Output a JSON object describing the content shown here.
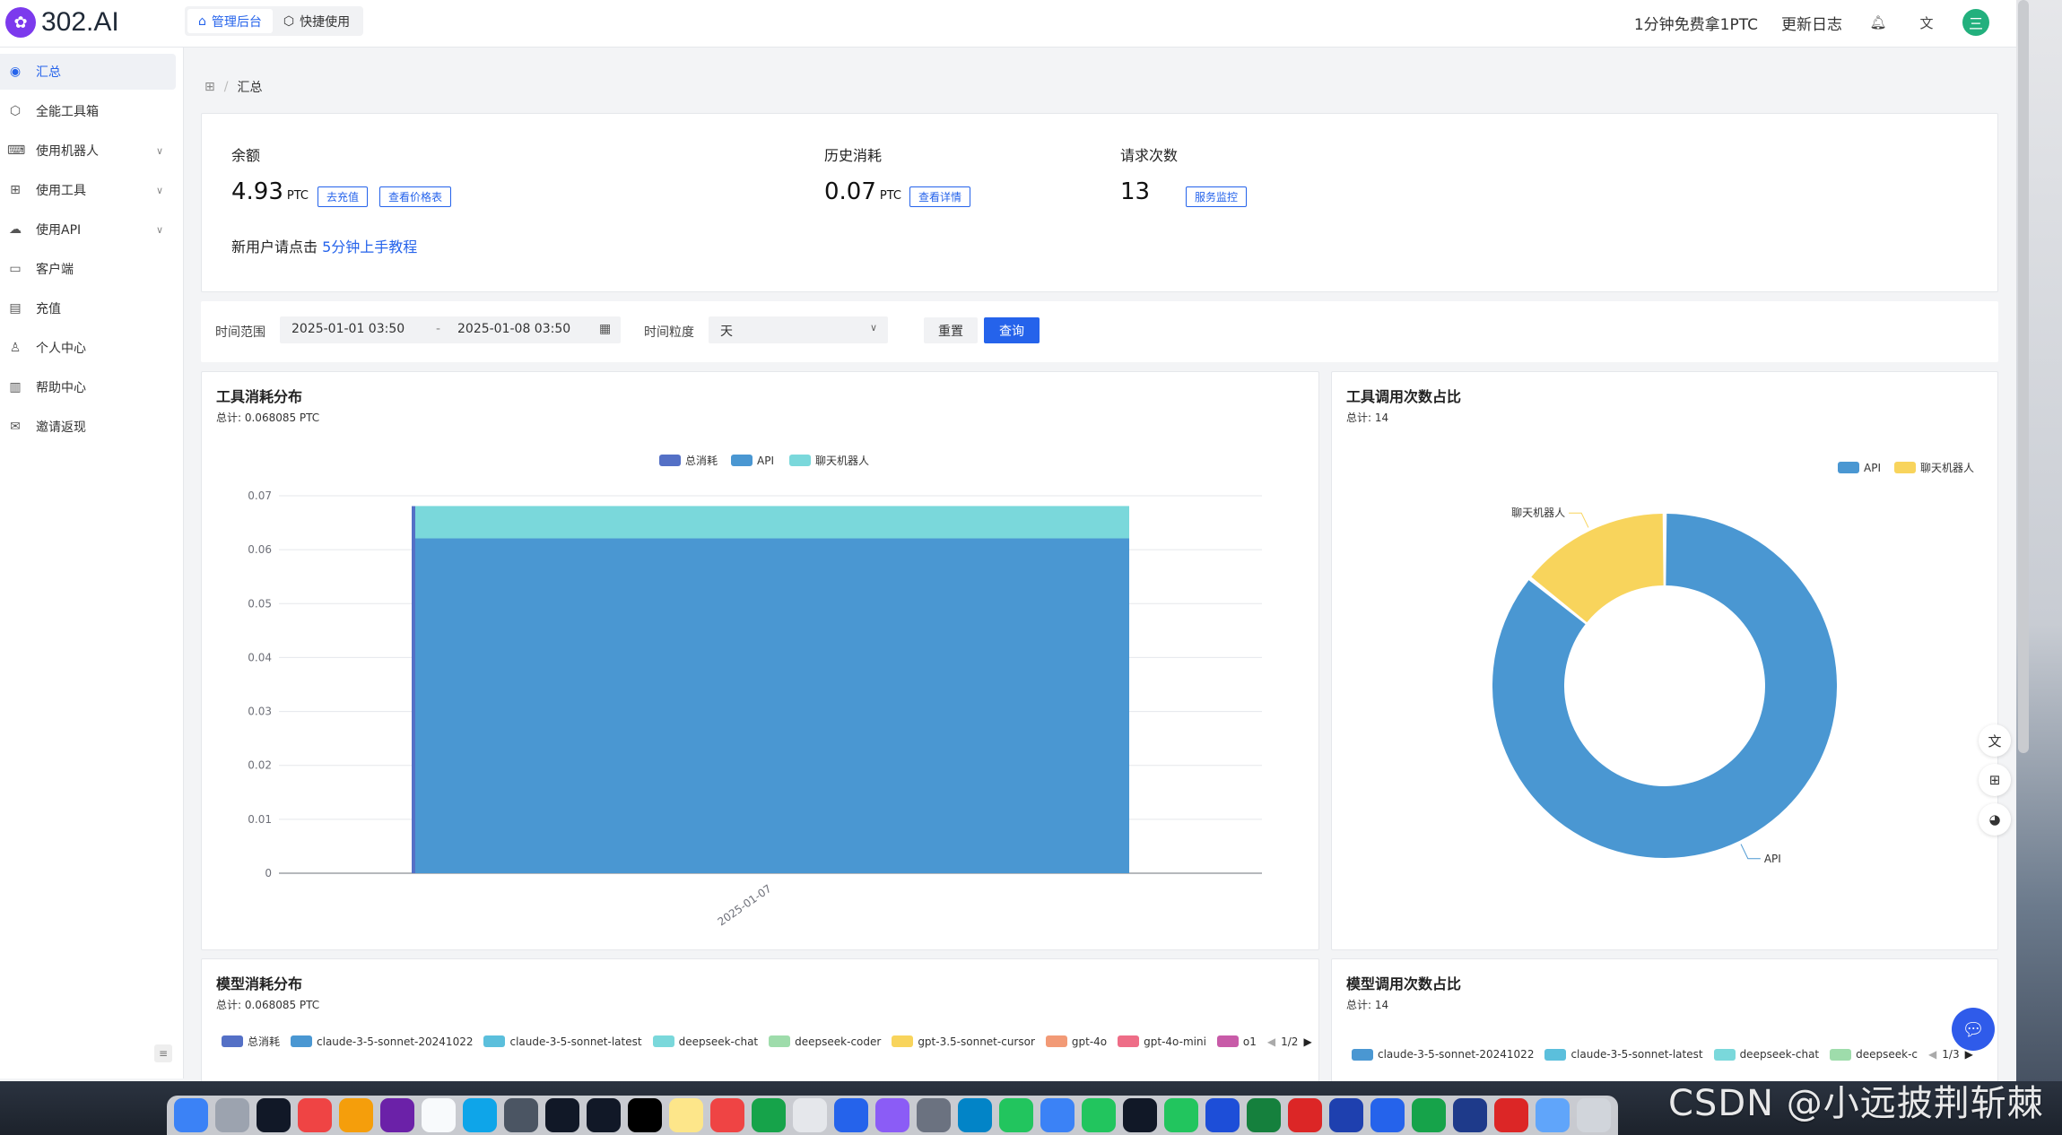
{
  "app": {
    "logo_text": "302.AI"
  },
  "top_tabs": [
    {
      "label": "管理后台",
      "icon": "home-icon"
    },
    {
      "label": "快捷使用",
      "icon": "cube-icon"
    }
  ],
  "top_right": {
    "free_link": "1分钟免费拿1PTC",
    "changelog": "更新日志",
    "avatar_glyph": "三"
  },
  "sidebar": {
    "items": [
      {
        "label": "汇总",
        "icon": "dashboard-icon",
        "active": true
      },
      {
        "label": "全能工具箱",
        "icon": "box-icon"
      },
      {
        "label": "使用机器人",
        "icon": "robot-icon",
        "expandable": true
      },
      {
        "label": "使用工具",
        "icon": "apps-icon",
        "expandable": true
      },
      {
        "label": "使用API",
        "icon": "cloud-icon",
        "expandable": true
      },
      {
        "label": "客户端",
        "icon": "monitor-icon"
      },
      {
        "label": "充值",
        "icon": "wallet-icon"
      },
      {
        "label": "个人中心",
        "icon": "user-icon"
      },
      {
        "label": "帮助中心",
        "icon": "book-icon"
      },
      {
        "label": "邀请返现",
        "icon": "gift-icon"
      }
    ]
  },
  "breadcrumb": {
    "current": "汇总"
  },
  "stats": {
    "balance": {
      "title": "余额",
      "value": "4.93",
      "unit": "PTC",
      "btn1": "去充值",
      "btn2": "查看价格表"
    },
    "history": {
      "title": "历史消耗",
      "value": "0.07",
      "unit": "PTC",
      "btn": "查看详情"
    },
    "requests": {
      "title": "请求次数",
      "value": "13",
      "btn": "服务监控"
    },
    "tip_prefix": "新用户请点击 ",
    "tip_link": "5分钟上手教程"
  },
  "filter": {
    "range_label": "时间范围",
    "start": "2025-01-01 03:50",
    "sep": "-",
    "end": "2025-01-08 03:50",
    "granularity_label": "时间粒度",
    "granularity_value": "天",
    "reset": "重置",
    "query": "查询"
  },
  "tool_cost_card": {
    "title": "工具消耗分布",
    "subtitle": "总计: 0.068085 PTC"
  },
  "tool_calls_card": {
    "title": "工具调用次数占比",
    "subtitle": "总计: 14"
  },
  "model_cost_card": {
    "title": "模型消耗分布",
    "subtitle": "总计: 0.068085 PTC",
    "legend": [
      {
        "name": "总消耗",
        "color": "#5470c6"
      },
      {
        "name": "claude-3-5-sonnet-20241022",
        "color": "#4a97d2"
      },
      {
        "name": "claude-3-5-sonnet-latest",
        "color": "#5bbfdc"
      },
      {
        "name": "deepseek-chat",
        "color": "#7ad8db"
      },
      {
        "name": "deepseek-coder",
        "color": "#9edcab"
      },
      {
        "name": "gpt-3.5-sonnet-cursor",
        "color": "#f8d45c"
      },
      {
        "name": "gpt-4o",
        "color": "#f29a76"
      },
      {
        "name": "gpt-4o-mini",
        "color": "#ee6d87"
      },
      {
        "name": "o1",
        "color": "#c85ba8"
      }
    ],
    "pager": "1/2"
  },
  "model_calls_card": {
    "title": "模型调用次数占比",
    "subtitle": "总计: 14",
    "legend": [
      {
        "name": "claude-3-5-sonnet-20241022",
        "color": "#4a97d2"
      },
      {
        "name": "claude-3-5-sonnet-latest",
        "color": "#5bbfdc"
      },
      {
        "name": "deepseek-chat",
        "color": "#7ad8db"
      },
      {
        "name": "deepseek-c",
        "color": "#9edcab"
      }
    ],
    "pager": "1/3"
  },
  "chart_data": [
    {
      "type": "bar",
      "title": "工具消耗分布",
      "categories": [
        "2025-01-07"
      ],
      "series": [
        {
          "name": "总消耗",
          "values": [
            0.068085
          ],
          "color": "#5470c6"
        },
        {
          "name": "API",
          "values": [
            0.0621
          ],
          "color": "#4a97d2",
          "stack": "s"
        },
        {
          "name": "聊天机器人",
          "values": [
            0.006
          ],
          "color": "#7ad8db",
          "stack": "s"
        }
      ],
      "yticks": [
        "0",
        "0.01",
        "0.02",
        "0.03",
        "0.04",
        "0.05",
        "0.06",
        "0.07"
      ],
      "ylim": [
        0,
        0.07
      ],
      "legend_position": "top-center"
    },
    {
      "type": "pie",
      "title": "工具调用次数占比",
      "slices": [
        {
          "name": "API",
          "value": 12,
          "color": "#4a97d2"
        },
        {
          "name": "聊天机器人",
          "value": 2,
          "color": "#f8d45c"
        }
      ],
      "legend_position": "top-right"
    }
  ],
  "dock_watermark": "CSDN @小远披荆斩棘"
}
